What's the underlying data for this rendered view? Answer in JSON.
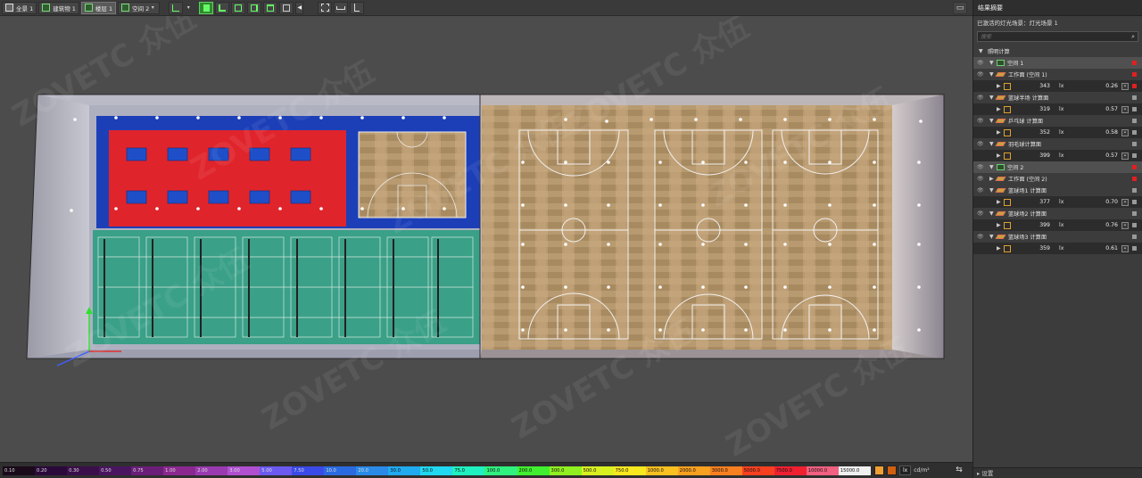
{
  "toolbar": {
    "scene_view": "全景 1",
    "building": "建筑物 1",
    "floor": "楼层 1",
    "space": "空间 2",
    "space_caret": "▾",
    "ground_caret": "▾",
    "view_arrow": "◀"
  },
  "watermark": {
    "text": "ZOVETC 众伍"
  },
  "panel": {
    "title": "结果摘要",
    "active_scene_label": "已激活的灯光场景：灯光场景 1",
    "search_placeholder": "搜索",
    "section_label": "照明计算",
    "settings_label": "设置",
    "spaces": [
      {
        "name": "空间 1",
        "flag": "red",
        "children": [
          {
            "type": "plane",
            "name": "工作面 (空间 1)",
            "flag": "red",
            "result": {
              "value": "343",
              "unit": "lx",
              "ratio": "0.26",
              "flag": "red"
            }
          },
          {
            "type": "plane",
            "name": "篮球半场 计算面",
            "flag": "grey",
            "result": {
              "value": "319",
              "unit": "lx",
              "ratio": "0.57",
              "flag": "grey"
            }
          },
          {
            "type": "plane",
            "name": "乒乓球 计算面",
            "flag": "grey",
            "result": {
              "value": "352",
              "unit": "lx",
              "ratio": "0.58",
              "flag": "grey"
            }
          },
          {
            "type": "plane",
            "name": "羽毛球计算面",
            "flag": "grey",
            "result": {
              "value": "399",
              "unit": "lx",
              "ratio": "0.57",
              "flag": "grey"
            }
          }
        ]
      },
      {
        "name": "空间 2",
        "flag": "red",
        "children": [
          {
            "type": "plane",
            "name": "工作面 (空间 2)",
            "flag": "red",
            "result": null
          },
          {
            "type": "plane",
            "name": "篮球场1 计算面",
            "flag": "grey",
            "result": {
              "value": "377",
              "unit": "lx",
              "ratio": "0.70",
              "flag": "grey"
            }
          },
          {
            "type": "plane",
            "name": "篮球场2 计算面",
            "flag": "grey",
            "result": {
              "value": "399",
              "unit": "lx",
              "ratio": "0.76",
              "flag": "grey"
            }
          },
          {
            "type": "plane",
            "name": "篮球场3 计算面",
            "flag": "grey",
            "result": {
              "value": "359",
              "unit": "lx",
              "ratio": "0.61",
              "flag": "grey"
            }
          }
        ]
      }
    ]
  },
  "legend": {
    "values": [
      "0.10",
      "0.20",
      "0.30",
      "0.50",
      "0.75",
      "1.00",
      "2.00",
      "3.00",
      "5.00",
      "7.50",
      "10.0",
      "20.0",
      "30.0",
      "50.0",
      "75.0",
      "100.0",
      "200.0",
      "300.0",
      "500.0",
      "750.0",
      "1000.0",
      "2000.0",
      "3000.0",
      "5000.0",
      "7500.0",
      "10000.0",
      "15000.0"
    ],
    "colors": [
      "#1a0a1a",
      "#2a0a3a",
      "#3a0f4a",
      "#4a1560",
      "#6a1e78",
      "#8a2890",
      "#9a3ab0",
      "#b050d0",
      "#6a5af0",
      "#3a4ae8",
      "#2a6ae0",
      "#2a8ae8",
      "#20aaf0",
      "#20d8f0",
      "#20f0c0",
      "#30f080",
      "#40f030",
      "#90f020",
      "#d8f020",
      "#f8e820",
      "#f8c020",
      "#f8a020",
      "#f88020",
      "#f84020",
      "#f02030",
      "#f06080",
      "#f0f0f0"
    ],
    "unit_lx": "lx",
    "unit_cd": "cd/m²",
    "swatch_colors": [
      "#f0a030",
      "#d06010"
    ]
  }
}
